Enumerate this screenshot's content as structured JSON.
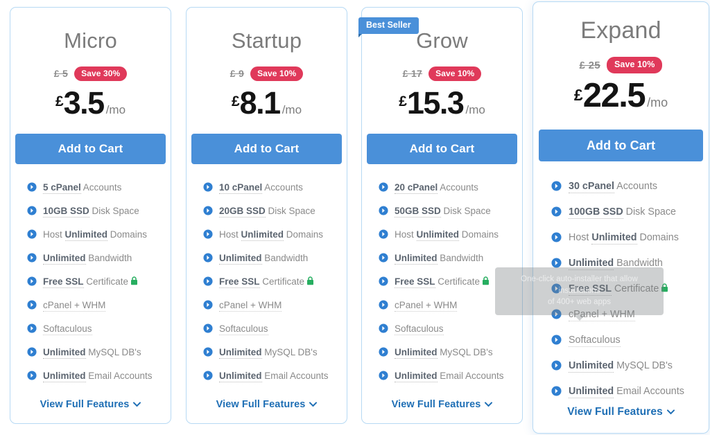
{
  "colors": {
    "card_border": "#b6d9f4",
    "cta_blue": "#4a90d9",
    "save_red": "#e0395a",
    "link_blue": "#1f6fb5",
    "plan_name_gray": "#7b7b7b",
    "lock_green": "#27ae60"
  },
  "common": {
    "cta_label": "Add to Cart",
    "full_features_label": "View Full Features",
    "chevron_glyph": "⌄",
    "currency_symbol": "£",
    "per_month_label": "/mo",
    "best_seller_label": "Best Seller"
  },
  "tooltip": {
    "line1": "One-click auto-installer that allow installations",
    "line2": "of 400+ web apps"
  },
  "plans": [
    {
      "name": "Micro",
      "old_price": "£ 5",
      "save_label": "Save 30%",
      "currency": "£",
      "amount": "3.5",
      "per": "/mo",
      "badge": null,
      "features": [
        {
          "strong": "5 cPanel",
          "rest": " Accounts",
          "lock": false
        },
        {
          "strong": "10GB SSD",
          "rest": " Disk Space",
          "lock": false
        },
        {
          "pre": "Host ",
          "strong": "Unlimited",
          "rest": " Domains",
          "lock": false
        },
        {
          "strong": "Unlimited",
          "rest": " Bandwidth",
          "lock": false
        },
        {
          "strong": "Free SSL",
          "rest": " Certificate",
          "lock": true
        },
        {
          "plain": "cPanel + WHM",
          "lock": false
        },
        {
          "plain": "Softaculous",
          "lock": false
        },
        {
          "strong": "Unlimited",
          "rest": " MySQL DB's",
          "lock": false
        },
        {
          "strong": "Unlimited",
          "rest": " Email Accounts",
          "lock": false
        }
      ]
    },
    {
      "name": "Startup",
      "old_price": "£ 9",
      "save_label": "Save 10%",
      "currency": "£",
      "amount": "8.1",
      "per": "/mo",
      "badge": null,
      "features": [
        {
          "strong": "10 cPanel",
          "rest": " Accounts",
          "lock": false
        },
        {
          "strong": "20GB SSD",
          "rest": " Disk Space",
          "lock": false
        },
        {
          "pre": "Host ",
          "strong": "Unlimited",
          "rest": " Domains",
          "lock": false
        },
        {
          "strong": "Unlimited",
          "rest": " Bandwidth",
          "lock": false
        },
        {
          "strong": "Free SSL",
          "rest": " Certificate",
          "lock": true
        },
        {
          "plain": "cPanel + WHM",
          "lock": false
        },
        {
          "plain": "Softaculous",
          "lock": false
        },
        {
          "strong": "Unlimited",
          "rest": " MySQL DB's",
          "lock": false
        },
        {
          "strong": "Unlimited",
          "rest": " Email Accounts",
          "lock": false
        }
      ]
    },
    {
      "name": "Grow",
      "old_price": "£ 17",
      "save_label": "Save 10%",
      "currency": "£",
      "amount": "15.3",
      "per": "/mo",
      "badge": "Best Seller",
      "features": [
        {
          "strong": "20 cPanel",
          "rest": " Accounts",
          "lock": false
        },
        {
          "strong": "50GB SSD",
          "rest": " Disk Space",
          "lock": false
        },
        {
          "pre": "Host ",
          "strong": "Unlimited",
          "rest": " Domains",
          "lock": false
        },
        {
          "strong": "Unlimited",
          "rest": " Bandwidth",
          "lock": false
        },
        {
          "strong": "Free SSL",
          "rest": " Certificate",
          "lock": true
        },
        {
          "plain": "cPanel + WHM",
          "lock": false
        },
        {
          "plain": "Softaculous",
          "lock": false
        },
        {
          "strong": "Unlimited",
          "rest": " MySQL DB's",
          "lock": false
        },
        {
          "strong": "Unlimited",
          "rest": " Email Accounts",
          "lock": false
        }
      ]
    },
    {
      "name": "Expand",
      "old_price": "£ 25",
      "save_label": "Save 10%",
      "currency": "£",
      "amount": "22.5",
      "per": "/mo",
      "badge": null,
      "features": [
        {
          "strong": "30 cPanel",
          "rest": " Accounts",
          "lock": false
        },
        {
          "strong": "100GB SSD",
          "rest": " Disk Space",
          "lock": false
        },
        {
          "pre": "Host ",
          "strong": "Unlimited",
          "rest": " Domains",
          "lock": false
        },
        {
          "strong": "Unlimited",
          "rest": " Bandwidth",
          "lock": false
        },
        {
          "strong": "Free SSL",
          "rest": " Certificate",
          "lock": true
        },
        {
          "plain": "cPanel + WHM",
          "lock": false
        },
        {
          "plain": "Softaculous",
          "lock": false
        },
        {
          "strong": "Unlimited",
          "rest": " MySQL DB's",
          "lock": false
        },
        {
          "strong": "Unlimited",
          "rest": " Email Accounts",
          "lock": false
        }
      ]
    }
  ]
}
